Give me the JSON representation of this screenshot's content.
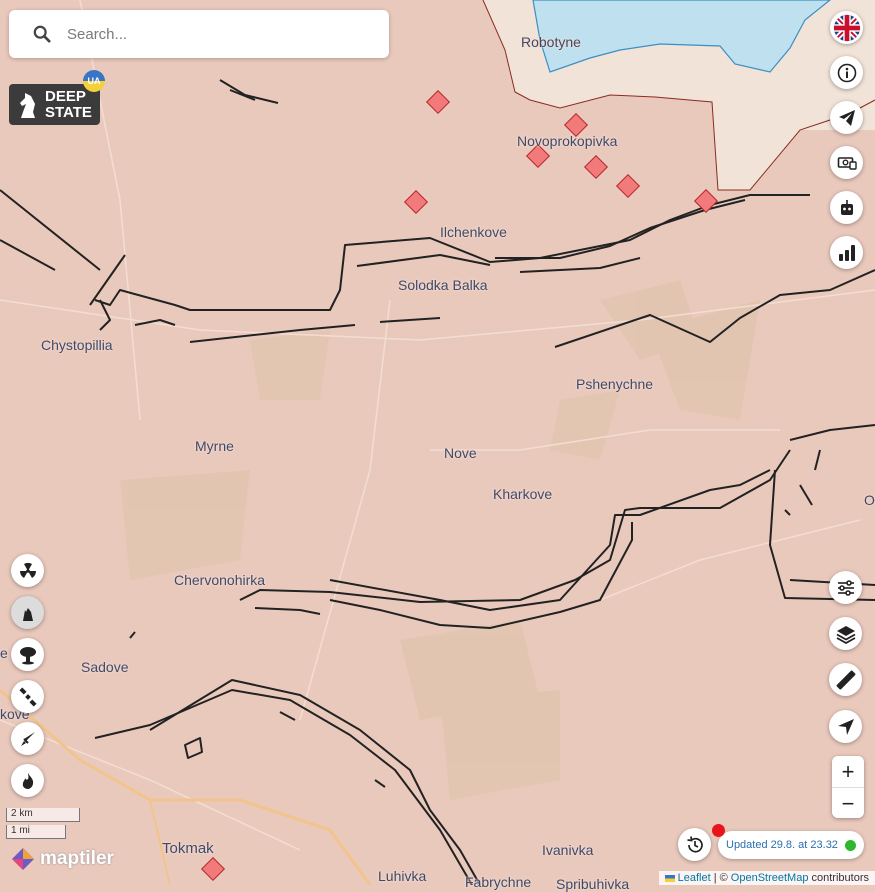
{
  "search": {
    "placeholder": "Search..."
  },
  "logo": {
    "line1": "DEEP",
    "line2": "STATE",
    "badge": "UA"
  },
  "places": [
    {
      "id": "robotyne",
      "name": "Robotyne"
    },
    {
      "id": "novoprokopivka",
      "name": "Novoprokopivka"
    },
    {
      "id": "ilchenkove",
      "name": "Ilchenkove"
    },
    {
      "id": "solodka-balka",
      "name": "Solodka Balka"
    },
    {
      "id": "chystopillia",
      "name": "Chystopillia"
    },
    {
      "id": "pshenychne",
      "name": "Pshenychne"
    },
    {
      "id": "myrne",
      "name": "Myrne"
    },
    {
      "id": "nove",
      "name": "Nove"
    },
    {
      "id": "kharkove",
      "name": "Kharkove"
    },
    {
      "id": "chervonohirka",
      "name": "Chervonohirka"
    },
    {
      "id": "sadove",
      "name": "Sadove"
    },
    {
      "id": "tokmak",
      "name": "Tokmak"
    },
    {
      "id": "ivanivka",
      "name": "Ivanivka"
    },
    {
      "id": "luhivka",
      "name": "Luhivka"
    },
    {
      "id": "fabrychne",
      "name": "Fabrychne"
    },
    {
      "id": "spribuhivka",
      "name": "Spribuhivka"
    },
    {
      "id": "edge-e",
      "name": "e"
    },
    {
      "id": "edge-kove",
      "name": "kove"
    },
    {
      "id": "edge-o",
      "name": "O"
    }
  ],
  "right_toolbar": [
    {
      "id": "language",
      "icon": "uk-flag-icon"
    },
    {
      "id": "info",
      "icon": "info-icon"
    },
    {
      "id": "telegram",
      "icon": "telegram-icon"
    },
    {
      "id": "donate",
      "icon": "donate-icon"
    },
    {
      "id": "bot",
      "icon": "robot-icon"
    },
    {
      "id": "stats",
      "icon": "bar-chart-icon"
    }
  ],
  "right_tools": [
    {
      "id": "filters",
      "icon": "sliders-icon"
    },
    {
      "id": "layers",
      "icon": "layers-icon"
    },
    {
      "id": "ruler",
      "icon": "ruler-icon"
    },
    {
      "id": "locate",
      "icon": "navigation-arrow-icon"
    }
  ],
  "left_tools": [
    {
      "id": "nuclear",
      "icon": "radiation-icon"
    },
    {
      "id": "fortification",
      "icon": "fortification-icon"
    },
    {
      "id": "explosion",
      "icon": "mushroom-cloud-icon"
    },
    {
      "id": "satellite",
      "icon": "satellite-icon"
    },
    {
      "id": "missile",
      "icon": "missile-icon"
    },
    {
      "id": "fire",
      "icon": "fire-icon"
    }
  ],
  "zoom": {
    "in_label": "+",
    "out_label": "−"
  },
  "status": {
    "updated_text": "Updated 29.8. at 23.32"
  },
  "scale": {
    "km_label": "2 km",
    "mi_label": "1 mi"
  },
  "attribution": {
    "leaflet": "Leaflet",
    "separator": "| ©",
    "osm": "OpenStreetMap",
    "contributors": "contributors"
  },
  "maptiler": {
    "brand": "maptiler"
  },
  "colors": {
    "occupied": "#eac9bd",
    "liberated": "#bfe0ee",
    "contested": "#f1e3d8",
    "front_line": "#8a2c1f",
    "fortification_line": "#222222",
    "marker_fill": "#f37a7a",
    "marker_stroke": "#b3262a",
    "updated_text": "#2a6fb0",
    "live_dot": "#2db82d",
    "alert_dot": "#e8141b"
  }
}
